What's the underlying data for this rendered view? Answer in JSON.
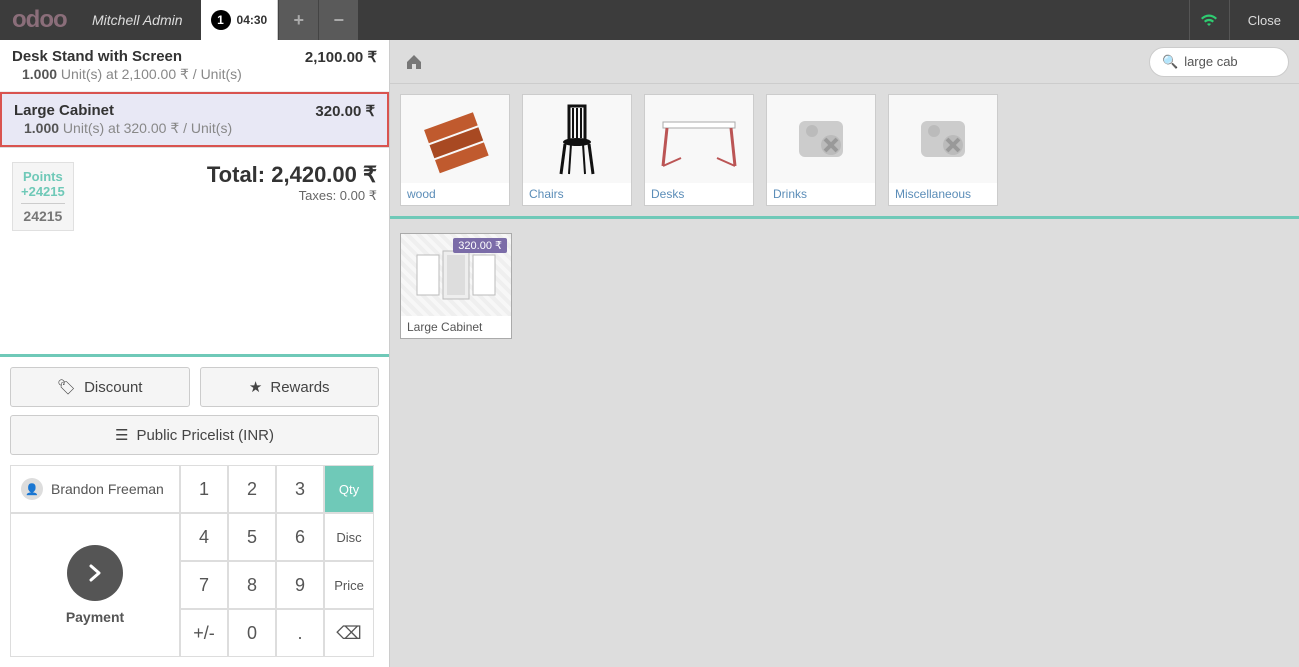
{
  "header": {
    "logo_text": "odoo",
    "username": "Mitchell Admin",
    "order_seq": "1",
    "order_time": "04:30",
    "close": "Close"
  },
  "orderlines": [
    {
      "name": "Desk Stand with Screen",
      "price": "2,100.00 ₹",
      "qty": "1.000",
      "detail": "Unit(s) at 2,100.00 ₹ / Unit(s)",
      "selected": false
    },
    {
      "name": "Large Cabinet",
      "price": "320.00 ₹",
      "qty": "1.000",
      "detail": "Unit(s) at 320.00 ₹ / Unit(s)",
      "selected": true
    }
  ],
  "points": {
    "label": "Points",
    "add": "+24215",
    "total": "24215"
  },
  "totals": {
    "label": "Total:",
    "amount": "2,420.00 ₹",
    "taxes": "Taxes: 0.00 ₹"
  },
  "buttons": {
    "discount": "Discount",
    "rewards": "Rewards",
    "pricelist": "Public Pricelist (INR)"
  },
  "customer": {
    "name": "Brandon Freeman"
  },
  "payment": {
    "label": "Payment"
  },
  "numpad": {
    "keys": [
      "1",
      "2",
      "3",
      "4",
      "5",
      "6",
      "7",
      "8",
      "9",
      "+/-",
      "0",
      "."
    ],
    "modes": [
      "Qty",
      "Disc",
      "Price"
    ],
    "active_mode": "Qty"
  },
  "search": {
    "value": "large cab"
  },
  "categories": [
    {
      "name": "wood"
    },
    {
      "name": "Chairs"
    },
    {
      "name": "Desks"
    },
    {
      "name": "Drinks"
    },
    {
      "name": "Miscellaneous"
    }
  ],
  "products": [
    {
      "name": "Large Cabinet",
      "price": "320.00 ₹"
    }
  ]
}
